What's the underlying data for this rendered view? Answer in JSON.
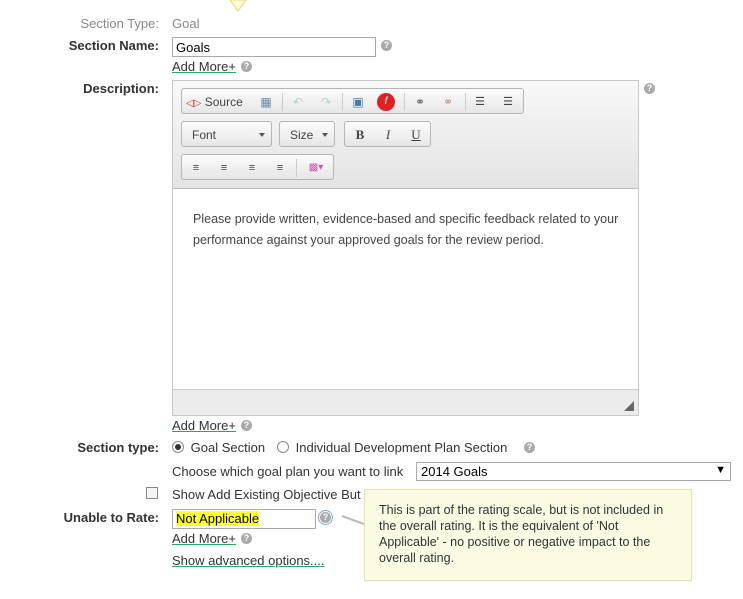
{
  "section_type": {
    "label": "Section Type:",
    "value": "Goal"
  },
  "section_name": {
    "label": "Section Name:",
    "value": "Goals",
    "add_more": "Add More+"
  },
  "description": {
    "label": "Description:",
    "toolbar": {
      "source": "Source",
      "font": "Font",
      "size": "Size",
      "bold": "B",
      "italic": "I",
      "underline": "U"
    },
    "content": "Please provide written, evidence-based and specific feedback related to your performance against your approved goals for the review period.",
    "add_more": "Add More+"
  },
  "section_type_choice": {
    "label": "Section type:",
    "options": [
      "Goal Section",
      "Individual Development Plan Section"
    ],
    "selected": "Goal Section"
  },
  "goal_plan": {
    "label": "Choose which goal plan you want to link",
    "selected": "2014 Goals"
  },
  "show_add_existing": {
    "label": "Show Add Existing Objective But",
    "checked": false
  },
  "unable_to_rate": {
    "label": "Unable to Rate:",
    "value": "Not Applicable",
    "add_more": "Add More+"
  },
  "advanced_options": "Show advanced options....",
  "tooltip": "This is part of the rating scale, but is not included in the overall rating. It is the equivalent of 'Not Applicable' - no positive or negative impact to the overall rating.",
  "colors": {
    "highlight": "#ffff33",
    "tooltip_bg": "#fbfbe3",
    "link_underline": "#22aa66"
  }
}
